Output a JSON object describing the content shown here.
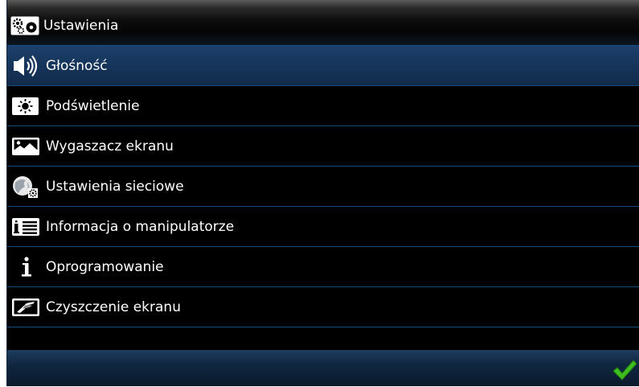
{
  "header": {
    "title": "Ustawienia",
    "icon": "settings-gears-icon"
  },
  "menu": {
    "items": [
      {
        "label": "Głośność",
        "icon": "speaker-icon",
        "selected": true
      },
      {
        "label": "Podświetlenie",
        "icon": "brightness-icon",
        "selected": false
      },
      {
        "label": "Wygaszacz ekranu",
        "icon": "screensaver-image-icon",
        "selected": false
      },
      {
        "label": "Ustawienia sieciowe",
        "icon": "network-globe-gear-icon",
        "selected": false
      },
      {
        "label": "Informacja o manipulatorze",
        "icon": "info-list-icon",
        "selected": false
      },
      {
        "label": "Oprogramowanie",
        "icon": "info-i-icon",
        "selected": false
      },
      {
        "label": "Czyszczenie ekranu",
        "icon": "cleaning-hand-icon",
        "selected": false
      }
    ]
  },
  "footer": {
    "confirm_icon": "checkmark-icon"
  },
  "colors": {
    "background": "#000000",
    "selected_row": "#163459",
    "row_divider": "#1b4b7b",
    "footer": "#10263f",
    "confirm": "#3fbf1f"
  }
}
